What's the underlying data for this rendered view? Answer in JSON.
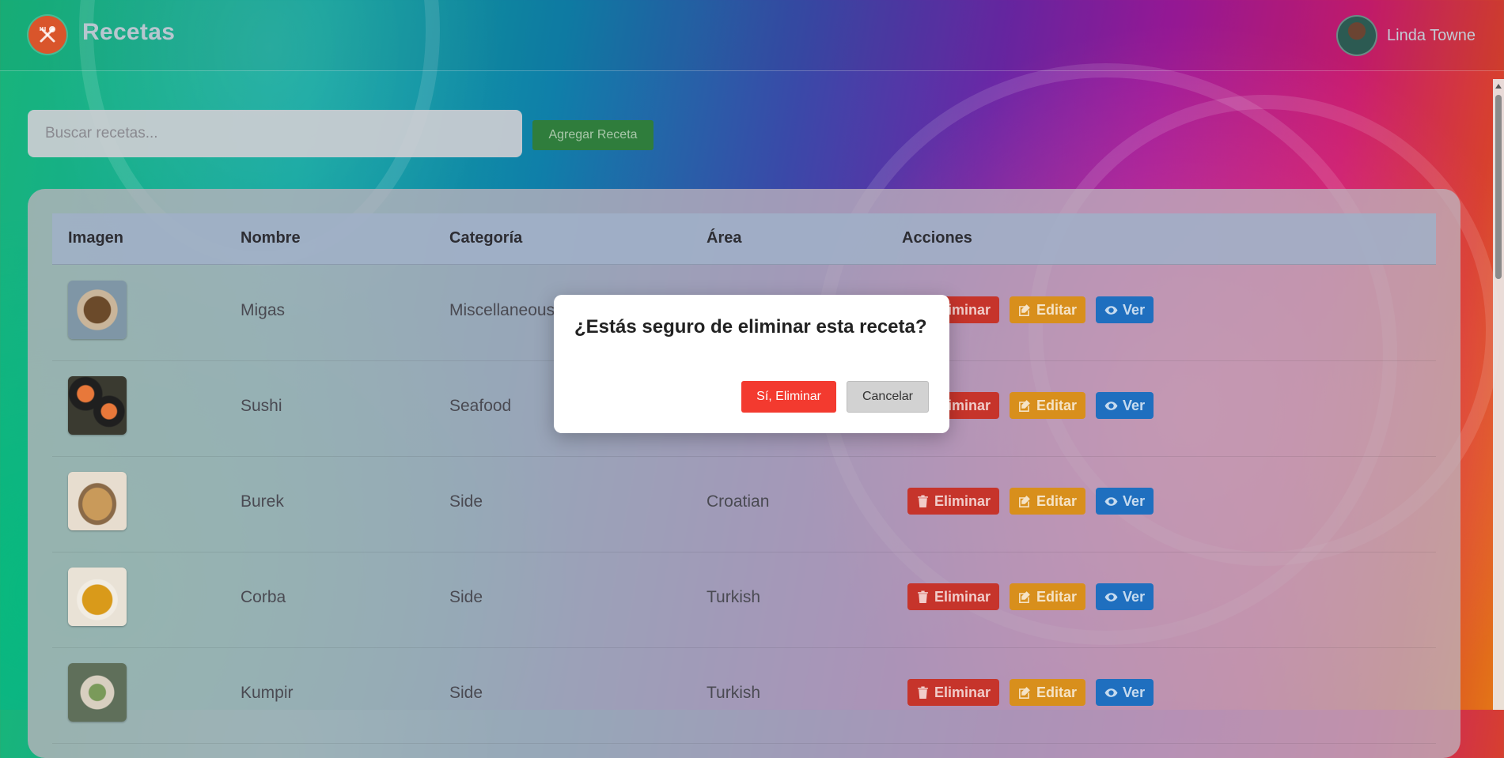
{
  "header": {
    "brand": "Recetas",
    "user_name": "Linda Towne",
    "logo_icon": "fork-spoon-icon"
  },
  "toolbar": {
    "search_placeholder": "Buscar recetas...",
    "add_label": "Agregar Receta"
  },
  "table": {
    "columns": [
      "Imagen",
      "Nombre",
      "Categoría",
      "Área",
      "Acciones"
    ],
    "rows": [
      {
        "name": "Migas",
        "category": "Miscellaneous",
        "area": ""
      },
      {
        "name": "Sushi",
        "category": "Seafood",
        "area": ""
      },
      {
        "name": "Burek",
        "category": "Side",
        "area": "Croatian"
      },
      {
        "name": "Corba",
        "category": "Side",
        "area": "Turkish"
      },
      {
        "name": "Kumpir",
        "category": "Side",
        "area": "Turkish"
      }
    ],
    "actions": {
      "delete_label": "Eliminar",
      "edit_label": "Editar",
      "view_label": "Ver"
    }
  },
  "modal": {
    "title": "¿Estás seguro de eliminar esta receta?",
    "confirm_label": "Sí, Eliminar",
    "cancel_label": "Cancelar"
  },
  "colors": {
    "delete": "#c6342b",
    "edit": "#d88f1c",
    "view": "#1f6fbf",
    "add": "#2f7d3c",
    "confirm": "#f33a2f"
  }
}
